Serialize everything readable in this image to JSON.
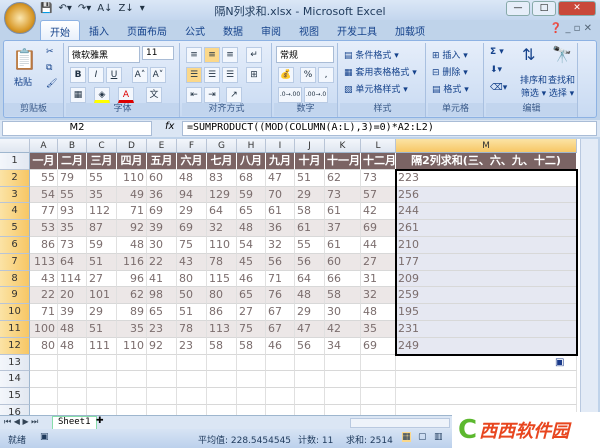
{
  "window": {
    "title": "隔N列求和.xlsx - Microsoft Excel",
    "qat": [
      "save-icon",
      "undo-icon",
      "redo-icon",
      "sort-asc-icon",
      "sort-desc-icon"
    ]
  },
  "tabs": [
    "开始",
    "插入",
    "页面布局",
    "公式",
    "数据",
    "审阅",
    "视图",
    "开发工具",
    "加载项"
  ],
  "ribbon": {
    "clipboard": {
      "label": "剪贴板",
      "paste": "粘贴"
    },
    "font": {
      "label": "字体",
      "name": "微软雅黑",
      "size": "11",
      "bold": "B",
      "italic": "I",
      "underline": "U",
      "grow": "A˄",
      "shrink": "A˅"
    },
    "alignment": {
      "label": "对齐方式"
    },
    "number": {
      "label": "数字",
      "format": "常规",
      "percent": "%",
      "comma": ",",
      "inc": ".0→.00",
      "dec": ".00→.0"
    },
    "styles": {
      "label": "样式",
      "items": [
        "条件格式 ▾",
        "套用表格格式 ▾",
        "单元格样式 ▾"
      ]
    },
    "cells": {
      "label": "单元格",
      "items": [
        "插入 ▾",
        "删除 ▾",
        "格式 ▾"
      ]
    },
    "editing": {
      "label": "编辑",
      "sigma": "Σ ▾",
      "sort": "排序和\n筛选 ▾",
      "find": "查找和\n选择 ▾"
    }
  },
  "formula_bar": {
    "name_box": "M2",
    "fx": "fx",
    "formula": "=SUMPRODUCT((MOD(COLUMN(A:L),3)=0)*A2:L2)"
  },
  "sheet": {
    "columns": [
      "A",
      "B",
      "C",
      "D",
      "E",
      "F",
      "G",
      "H",
      "I",
      "J",
      "K",
      "L",
      "M"
    ],
    "row_numbers": [
      "1",
      "2",
      "3",
      "4",
      "5",
      "6",
      "7",
      "8",
      "9",
      "10",
      "11",
      "12",
      "13",
      "14",
      "15",
      "16"
    ],
    "headers": [
      "一月",
      "二月",
      "三月",
      "四月",
      "五月",
      "六月",
      "七月",
      "八月",
      "九月",
      "十月",
      "十一月",
      "十二月",
      "隔2列求和(三、六、九、十二)"
    ],
    "rows": [
      [
        "55",
        "79",
        "55",
        "110",
        "60",
        "48",
        "83",
        "68",
        "47",
        "51",
        "62",
        "73",
        "223"
      ],
      [
        "54",
        "55",
        "35",
        "49",
        "36",
        "94",
        "129",
        "59",
        "70",
        "29",
        "73",
        "57",
        "256"
      ],
      [
        "77",
        "93",
        "112",
        "71",
        "69",
        "29",
        "64",
        "65",
        "61",
        "58",
        "61",
        "42",
        "244"
      ],
      [
        "53",
        "35",
        "87",
        "92",
        "39",
        "69",
        "32",
        "48",
        "36",
        "61",
        "37",
        "69",
        "261"
      ],
      [
        "86",
        "73",
        "59",
        "48",
        "30",
        "75",
        "110",
        "54",
        "32",
        "55",
        "61",
        "44",
        "210"
      ],
      [
        "113",
        "64",
        "51",
        "116",
        "22",
        "43",
        "78",
        "45",
        "56",
        "56",
        "60",
        "27",
        "177"
      ],
      [
        "43",
        "114",
        "27",
        "96",
        "41",
        "80",
        "115",
        "46",
        "71",
        "64",
        "66",
        "31",
        "209"
      ],
      [
        "22",
        "20",
        "101",
        "62",
        "98",
        "50",
        "80",
        "65",
        "76",
        "48",
        "58",
        "32",
        "259"
      ],
      [
        "71",
        "39",
        "29",
        "89",
        "65",
        "51",
        "86",
        "27",
        "67",
        "29",
        "30",
        "48",
        "195"
      ],
      [
        "100",
        "48",
        "51",
        "35",
        "23",
        "78",
        "113",
        "75",
        "67",
        "47",
        "42",
        "35",
        "231"
      ],
      [
        "80",
        "48",
        "111",
        "110",
        "92",
        "23",
        "58",
        "58",
        "46",
        "56",
        "34",
        "69",
        "249"
      ]
    ],
    "selected_column": "M",
    "selected_range": "M2:M12"
  },
  "sheet_tabs": [
    "Sheet1"
  ],
  "status": {
    "ready": "就绪",
    "average": "平均值: 228.5454545",
    "count": "计数: 11",
    "sum": "求和: 2514"
  },
  "watermark": {
    "text": "西西软件园",
    "sub": "CR173.COM"
  },
  "colors": {
    "header_bg": "#7b6464",
    "alt_row": "#ece7e7",
    "selection": "#e6e8f2",
    "accent": "#f7c765"
  }
}
